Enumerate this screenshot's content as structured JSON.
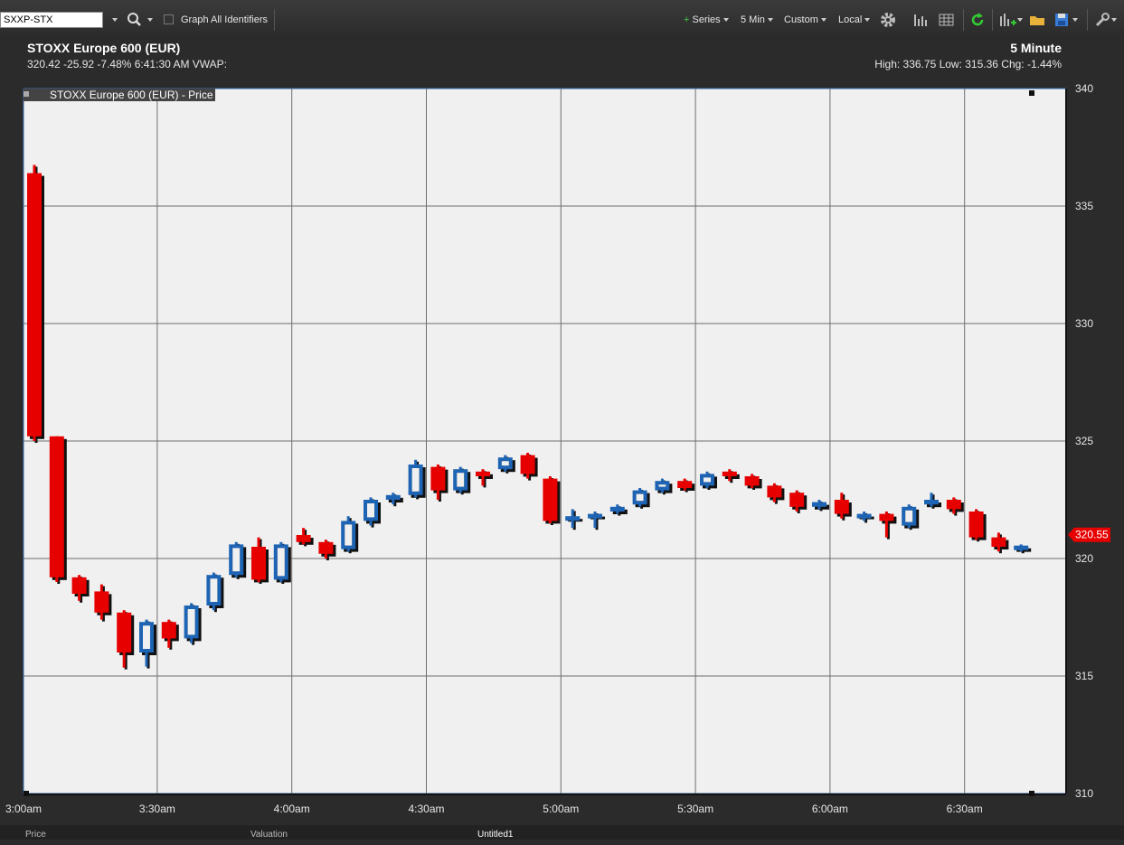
{
  "toolbar": {
    "symbol_value": "SXXP-STX",
    "graph_all_label": "Graph All Identifiers",
    "series_label": "Series",
    "interval_label": "5 Min",
    "custom_label": "Custom",
    "timezone_label": "Local"
  },
  "header": {
    "title": "STOXX Europe 600 (EUR)",
    "quote_line": "320.42 -25.92 -7.48% 6:41:30 AM VWAP:",
    "interval_title": "5 Minute",
    "stats_line": "High: 336.75 Low: 315.36 Chg: -1.44%"
  },
  "bottom_tabs": {
    "tab1": "Price",
    "tab2": "Valuation",
    "tab3": "Untitled1"
  },
  "colors": {
    "up": "#1e64b4",
    "down": "#e60000",
    "plot_bg": "#f0f0f0"
  },
  "chart_data": {
    "type": "candlestick",
    "legend": "STOXX Europe 600 (EUR) - Price",
    "interval_minutes": 5,
    "x_ticks": [
      "3:00am",
      "3:30am",
      "4:00am",
      "4:30am",
      "5:00am",
      "5:30am",
      "6:00am",
      "6:30am"
    ],
    "ylim": [
      310,
      340
    ],
    "y_ticks": [
      310,
      315,
      320,
      325,
      330,
      335,
      340
    ],
    "last_price_label": "320.55",
    "last_price": 320.55,
    "candles": [
      {
        "t": "3:00",
        "o": 336.4,
        "h": 336.75,
        "l": 325.0,
        "c": 325.2
      },
      {
        "t": "3:05",
        "o": 325.2,
        "h": 325.2,
        "l": 319.0,
        "c": 319.2
      },
      {
        "t": "3:10",
        "o": 319.2,
        "h": 319.3,
        "l": 318.2,
        "c": 318.5
      },
      {
        "t": "3:15",
        "o": 318.6,
        "h": 318.9,
        "l": 317.4,
        "c": 317.7
      },
      {
        "t": "3:20",
        "o": 317.7,
        "h": 317.8,
        "l": 315.36,
        "c": 316.0
      },
      {
        "t": "3:25",
        "o": 316.0,
        "h": 317.4,
        "l": 315.4,
        "c": 317.3
      },
      {
        "t": "3:30",
        "o": 317.3,
        "h": 317.4,
        "l": 316.2,
        "c": 316.6
      },
      {
        "t": "3:35",
        "o": 316.6,
        "h": 318.1,
        "l": 316.4,
        "c": 318.0
      },
      {
        "t": "3:40",
        "o": 318.0,
        "h": 319.4,
        "l": 317.8,
        "c": 319.3
      },
      {
        "t": "3:45",
        "o": 319.3,
        "h": 320.7,
        "l": 319.2,
        "c": 320.6
      },
      {
        "t": "3:50",
        "o": 320.5,
        "h": 320.9,
        "l": 319.0,
        "c": 319.1
      },
      {
        "t": "3:55",
        "o": 319.1,
        "h": 320.7,
        "l": 319.0,
        "c": 320.6
      },
      {
        "t": "4:00",
        "o": 321.0,
        "h": 321.3,
        "l": 320.6,
        "c": 320.7
      },
      {
        "t": "4:05",
        "o": 320.7,
        "h": 320.8,
        "l": 320.0,
        "c": 320.2
      },
      {
        "t": "4:10",
        "o": 320.4,
        "h": 321.8,
        "l": 320.3,
        "c": 321.6
      },
      {
        "t": "4:15",
        "o": 321.6,
        "h": 322.6,
        "l": 321.4,
        "c": 322.5
      },
      {
        "t": "4:20",
        "o": 322.5,
        "h": 322.8,
        "l": 322.3,
        "c": 322.7
      },
      {
        "t": "4:25",
        "o": 322.7,
        "h": 324.2,
        "l": 322.6,
        "c": 324.0
      },
      {
        "t": "4:30",
        "o": 323.9,
        "h": 324.0,
        "l": 322.5,
        "c": 322.9
      },
      {
        "t": "4:35",
        "o": 322.9,
        "h": 323.9,
        "l": 322.8,
        "c": 323.8
      },
      {
        "t": "4:40",
        "o": 323.7,
        "h": 323.8,
        "l": 323.1,
        "c": 323.5
      },
      {
        "t": "4:45",
        "o": 323.8,
        "h": 324.4,
        "l": 323.7,
        "c": 324.3
      },
      {
        "t": "4:50",
        "o": 324.4,
        "h": 324.5,
        "l": 323.4,
        "c": 323.6
      },
      {
        "t": "4:55",
        "o": 323.4,
        "h": 323.5,
        "l": 321.5,
        "c": 321.6
      },
      {
        "t": "5:00",
        "o": 321.7,
        "h": 322.1,
        "l": 321.3,
        "c": 321.8
      },
      {
        "t": "5:05",
        "o": 321.8,
        "h": 322.0,
        "l": 321.3,
        "c": 321.9
      },
      {
        "t": "5:10",
        "o": 322.0,
        "h": 322.3,
        "l": 321.9,
        "c": 322.2
      },
      {
        "t": "5:15",
        "o": 322.3,
        "h": 323.0,
        "l": 322.2,
        "c": 322.9
      },
      {
        "t": "5:20",
        "o": 322.9,
        "h": 323.4,
        "l": 322.8,
        "c": 323.3
      },
      {
        "t": "5:25",
        "o": 323.3,
        "h": 323.4,
        "l": 322.9,
        "c": 323.0
      },
      {
        "t": "5:30",
        "o": 323.1,
        "h": 323.7,
        "l": 323.0,
        "c": 323.6
      },
      {
        "t": "5:35",
        "o": 323.7,
        "h": 323.8,
        "l": 323.3,
        "c": 323.5
      },
      {
        "t": "5:40",
        "o": 323.5,
        "h": 323.6,
        "l": 323.0,
        "c": 323.1
      },
      {
        "t": "5:45",
        "o": 323.1,
        "h": 323.2,
        "l": 322.4,
        "c": 322.6
      },
      {
        "t": "5:50",
        "o": 322.8,
        "h": 322.9,
        "l": 322.0,
        "c": 322.2
      },
      {
        "t": "5:55",
        "o": 322.2,
        "h": 322.5,
        "l": 322.1,
        "c": 322.4
      },
      {
        "t": "6:00",
        "o": 322.5,
        "h": 322.8,
        "l": 321.7,
        "c": 321.9
      },
      {
        "t": "6:05",
        "o": 321.8,
        "h": 322.0,
        "l": 321.6,
        "c": 321.9
      },
      {
        "t": "6:10",
        "o": 321.9,
        "h": 322.0,
        "l": 320.9,
        "c": 321.6
      },
      {
        "t": "6:15",
        "o": 321.4,
        "h": 322.3,
        "l": 321.3,
        "c": 322.2
      },
      {
        "t": "6:20",
        "o": 322.3,
        "h": 322.8,
        "l": 322.2,
        "c": 322.5
      },
      {
        "t": "6:25",
        "o": 322.5,
        "h": 322.6,
        "l": 321.9,
        "c": 322.1
      },
      {
        "t": "6:30",
        "o": 322.0,
        "h": 322.1,
        "l": 320.8,
        "c": 320.9
      },
      {
        "t": "6:35",
        "o": 320.9,
        "h": 321.1,
        "l": 320.3,
        "c": 320.5
      },
      {
        "t": "6:40",
        "o": 320.4,
        "h": 320.6,
        "l": 320.3,
        "c": 320.55
      }
    ]
  }
}
